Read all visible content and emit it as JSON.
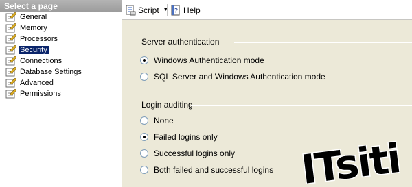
{
  "left_pane": {
    "header": "Select a page",
    "items": [
      {
        "label": "General"
      },
      {
        "label": "Memory"
      },
      {
        "label": "Processors"
      },
      {
        "label": "Security",
        "selected": true
      },
      {
        "label": "Connections"
      },
      {
        "label": "Database Settings"
      },
      {
        "label": "Advanced"
      },
      {
        "label": "Permissions"
      }
    ]
  },
  "toolbar": {
    "script_label": "Script",
    "help_label": "Help"
  },
  "server_auth": {
    "title": "Server authentication",
    "options": [
      {
        "label": "Windows Authentication mode",
        "checked": true
      },
      {
        "label": "SQL Server and Windows Authentication mode",
        "checked": false
      }
    ]
  },
  "login_auditing": {
    "title": "Login auditing",
    "options": [
      {
        "label": "None",
        "checked": false
      },
      {
        "label": "Failed logins only",
        "checked": true
      },
      {
        "label": "Successful logins only",
        "checked": false
      },
      {
        "label": "Both failed and successful logins",
        "checked": false
      }
    ]
  },
  "watermark": {
    "text": "ITsiti"
  },
  "colors": {
    "selection": "#0a246a",
    "header_bg": "#a8a8a8",
    "panel_bg": "#ece9d8"
  }
}
